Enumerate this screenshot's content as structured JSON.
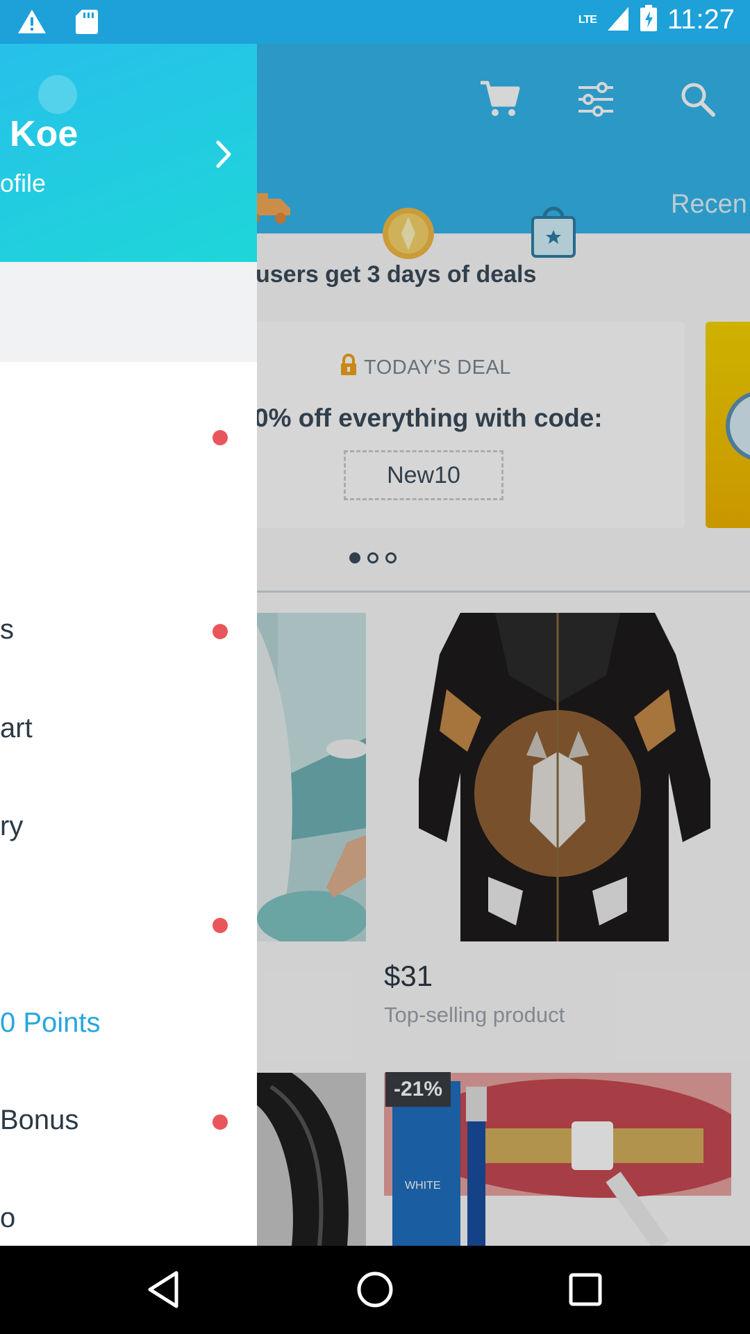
{
  "status_bar": {
    "network": "LTE",
    "time": "11:27",
    "icons": [
      "warning-icon",
      "sd-card-icon",
      "signal-icon",
      "battery-charging-icon"
    ]
  },
  "app_bar": {
    "actions": [
      "cart-icon",
      "filter-icon",
      "search-icon"
    ],
    "categories": [
      "truck-icon",
      "coin-icon",
      "bag-star-icon"
    ],
    "category_label": "Recen"
  },
  "promo": {
    "title": "users get 3 days of deals",
    "deal_label": "TODAY'S DEAL",
    "deal_text": "0% off everything with code:",
    "code": "New10",
    "pager": {
      "count": 3,
      "active": 0
    }
  },
  "products": [
    {
      "price": "$31",
      "description": "Top-selling product",
      "image": "wolf-hoodie"
    },
    {
      "badge": "-21%",
      "image": "teeth-whitening-pen",
      "package_text": "WHITE"
    }
  ],
  "drawer": {
    "user_name": "Koe",
    "profile_link": "ofile",
    "menu": [
      {
        "label": "",
        "badge": true
      },
      {
        "label": "s",
        "badge": true
      },
      {
        "label": "art",
        "badge": false
      },
      {
        "label": "ry",
        "badge": false
      },
      {
        "label": "",
        "badge": true
      },
      {
        "label": "0 Points",
        "badge": false,
        "accent": true
      },
      {
        "label": "Bonus",
        "badge": true
      },
      {
        "label": "o",
        "badge": false
      }
    ]
  },
  "colors": {
    "status_bar": "#1da1d8",
    "app_bar": "#35b5ec",
    "accent": "#26a6de",
    "badge": "#e8565b"
  },
  "nav_bar": [
    "back-icon",
    "home-icon",
    "recents-icon"
  ]
}
